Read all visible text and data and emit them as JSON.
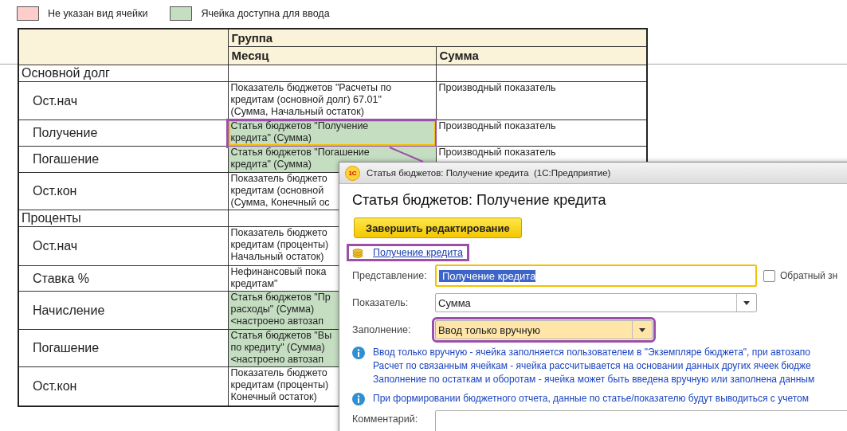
{
  "legend": [
    {
      "label": "Не указан вид ячейки",
      "color": "#ffcccc"
    },
    {
      "label": "Ячейка доступна для ввода",
      "color": "#c5dec2"
    }
  ],
  "table": {
    "group_header": "Группа",
    "columns": [
      "Месяц",
      "Сумма"
    ],
    "sections": [
      {
        "title": "Основной долг",
        "rows": [
          {
            "label": "Ост.нач",
            "cells": [
              {
                "text": "Показатель бюджетов \"Расчеты по\nкредитам (основной долг) 67.01\"\n(Сумма, Начальный остаток)",
                "editable": false,
                "selected": false,
                "highlighted": false
              },
              {
                "text": "Производный показатель",
                "editable": false,
                "selected": false,
                "highlighted": false
              }
            ]
          },
          {
            "label": "Получение",
            "cells": [
              {
                "text": "Статья бюджетов \"Получение\nкредита\" (Сумма)",
                "editable": true,
                "selected": true,
                "highlighted": true
              },
              {
                "text": "Производный показатель",
                "editable": false,
                "selected": false,
                "highlighted": false
              }
            ]
          },
          {
            "label": "Погашение",
            "cells": [
              {
                "text": "Статья бюджетов \"Погашение\nкредита\" (Сумма)",
                "editable": true,
                "selected": false,
                "highlighted": false
              },
              {
                "text": "Производный показатель",
                "editable": false,
                "selected": false,
                "highlighted": false
              }
            ]
          },
          {
            "label": "Ост.кон",
            "cells": [
              {
                "text": "Показатель бюджето\nкредитам (основной\n(Сумма, Конечный ос",
                "editable": false,
                "selected": false,
                "highlighted": false
              }
            ]
          }
        ]
      },
      {
        "title": "Проценты",
        "rows": [
          {
            "label": "Ост.нач",
            "cells": [
              {
                "text": "Показатель бюджето\nкредитам (проценты)\nНачальный остаток)",
                "editable": false,
                "selected": false,
                "highlighted": false
              }
            ]
          },
          {
            "label": "Ставка %",
            "cells": [
              {
                "text": "Нефинансовый пока\nкредитам\"",
                "editable": false,
                "selected": false,
                "highlighted": false
              }
            ]
          },
          {
            "label": "Начисление",
            "cells": [
              {
                "text": "Статья бюджетов \"Пр\nрасходы\" (Сумма)\n<настроено автозап",
                "editable": true,
                "selected": false,
                "highlighted": false
              }
            ]
          },
          {
            "label": "Погашение",
            "cells": [
              {
                "text": "Статья бюджетов \"Вы\nпо кредиту\" (Сумма)\n<настроено автозап",
                "editable": true,
                "selected": false,
                "highlighted": false
              }
            ]
          },
          {
            "label": "Ост.кон",
            "cells": [
              {
                "text": "Показатель бюджето\nкредитам (проценты)\nКонечный остаток)",
                "editable": false,
                "selected": false,
                "highlighted": false
              }
            ]
          }
        ]
      }
    ]
  },
  "dialog": {
    "title": "Статья бюджетов: Получение кредита  (1С:Предприятие)",
    "logo": "1С",
    "heading": "Статья бюджетов: Получение кредита",
    "primary_button": "Завершить редактирование",
    "link": {
      "text": "Получение кредита",
      "highlighted": true
    },
    "fields": [
      {
        "kind": "text",
        "label": "Представление:",
        "value": "Получение кредита",
        "focused": true,
        "highlighted": false,
        "marked": false
      },
      {
        "kind": "dropdown",
        "label": "Показатель:",
        "value": "Сумма",
        "focused": false,
        "highlighted": false,
        "marked": false
      },
      {
        "kind": "dropdown",
        "label": "Заполнение:",
        "value": "Ввод только вручную",
        "focused": false,
        "highlighted": true,
        "marked": true
      }
    ],
    "checkbox": {
      "label": "Обратный зн",
      "checked": false
    },
    "notes": [
      {
        "lines": [
          "Ввод только вручную - ячейка заполняется пользователем в \"Экземпляре бюджета\", при автозапо",
          "Расчет по связанным ячейкам - ячейка рассчитывается на основании данных других ячеек бюдже",
          "Заполнение по остаткам и оборотам - ячейка может быть введена вручную или заполнена данным"
        ]
      },
      {
        "lines": [
          "При формировании бюджетного отчета, данные по статье/показателю будут выводиться с учетом"
        ]
      }
    ],
    "comment_label": "Комментарий:"
  }
}
